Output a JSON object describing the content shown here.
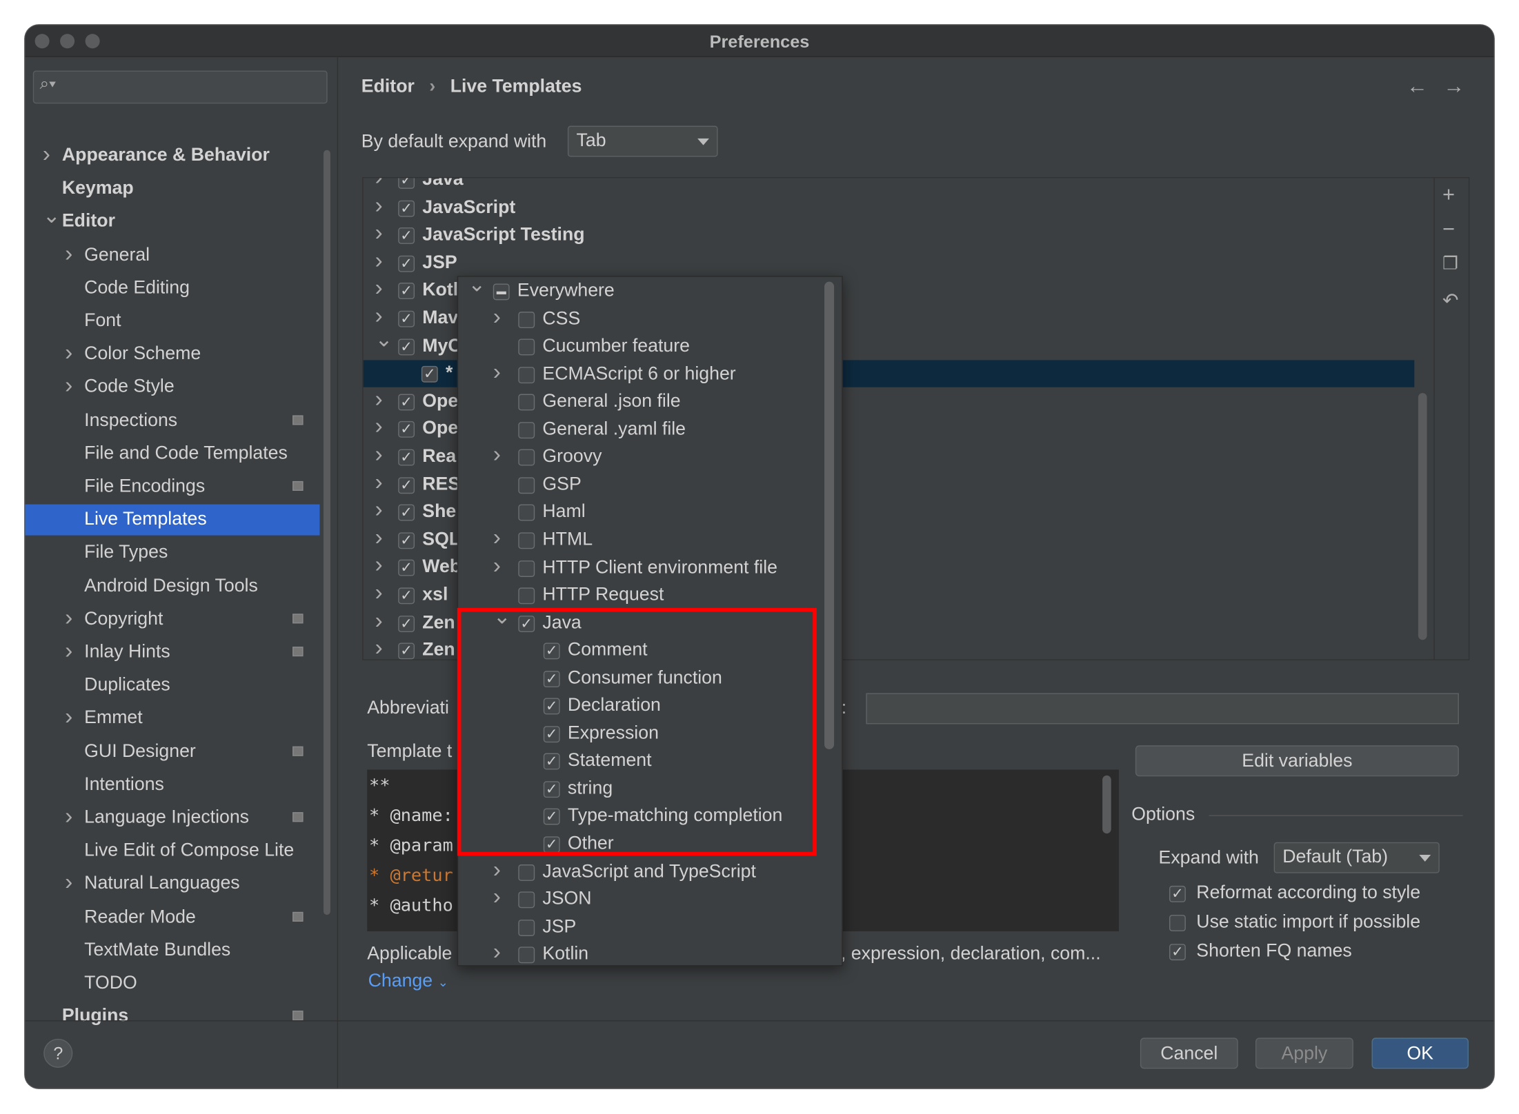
{
  "window": {
    "title": "Preferences"
  },
  "sidebar": {
    "search_placeholder": "",
    "items": [
      {
        "label": "Appearance & Behavior",
        "level": 0,
        "chevron": "right",
        "bold": true
      },
      {
        "label": "Keymap",
        "level": 0,
        "chevron": "",
        "bold": true
      },
      {
        "label": "Editor",
        "level": 0,
        "chevron": "down",
        "bold": true
      },
      {
        "label": "General",
        "level": 1,
        "chevron": "right"
      },
      {
        "label": "Code Editing",
        "level": 1,
        "chevron": ""
      },
      {
        "label": "Font",
        "level": 1,
        "chevron": ""
      },
      {
        "label": "Color Scheme",
        "level": 1,
        "chevron": "right"
      },
      {
        "label": "Code Style",
        "level": 1,
        "chevron": "right"
      },
      {
        "label": "Inspections",
        "level": 1,
        "chevron": "",
        "badge": true
      },
      {
        "label": "File and Code Templates",
        "level": 1,
        "chevron": ""
      },
      {
        "label": "File Encodings",
        "level": 1,
        "chevron": "",
        "badge": true
      },
      {
        "label": "Live Templates",
        "level": 1,
        "chevron": "",
        "selected": true
      },
      {
        "label": "File Types",
        "level": 1,
        "chevron": ""
      },
      {
        "label": "Android Design Tools",
        "level": 1,
        "chevron": ""
      },
      {
        "label": "Copyright",
        "level": 1,
        "chevron": "right",
        "badge": true
      },
      {
        "label": "Inlay Hints",
        "level": 1,
        "chevron": "right",
        "badge": true
      },
      {
        "label": "Duplicates",
        "level": 1,
        "chevron": ""
      },
      {
        "label": "Emmet",
        "level": 1,
        "chevron": "right"
      },
      {
        "label": "GUI Designer",
        "level": 1,
        "chevron": "",
        "badge": true
      },
      {
        "label": "Intentions",
        "level": 1,
        "chevron": ""
      },
      {
        "label": "Language Injections",
        "level": 1,
        "chevron": "right",
        "badge": true
      },
      {
        "label": "Live Edit of Compose Lite",
        "level": 1,
        "chevron": ""
      },
      {
        "label": "Natural Languages",
        "level": 1,
        "chevron": "right"
      },
      {
        "label": "Reader Mode",
        "level": 1,
        "chevron": "",
        "badge": true
      },
      {
        "label": "TextMate Bundles",
        "level": 1,
        "chevron": ""
      },
      {
        "label": "TODO",
        "level": 1,
        "chevron": ""
      },
      {
        "label": "Plugins",
        "level": 0,
        "chevron": "",
        "bold": true,
        "badge": true
      }
    ]
  },
  "breadcrumb": {
    "parent": "Editor",
    "separator": "›",
    "current": "Live Templates"
  },
  "expand": {
    "label": "By default expand with",
    "value": "Tab"
  },
  "template_groups": [
    {
      "label": "Java",
      "chevron": "right",
      "checked": true
    },
    {
      "label": "JavaScript",
      "chevron": "right",
      "checked": true
    },
    {
      "label": "JavaScript Testing",
      "chevron": "right",
      "checked": true
    },
    {
      "label": "JSP",
      "chevron": "right",
      "checked": true
    },
    {
      "label": "Kotl",
      "chevron": "right",
      "checked": true
    },
    {
      "label": "Mav",
      "chevron": "right",
      "checked": true
    },
    {
      "label": "MyC",
      "chevron": "down",
      "checked": true
    },
    {
      "label": "*",
      "chevron": "",
      "checked": true,
      "child": true,
      "selected": true
    },
    {
      "label": "Ope",
      "chevron": "right",
      "checked": true
    },
    {
      "label": "Ope",
      "chevron": "right",
      "checked": true
    },
    {
      "label": "Rea",
      "chevron": "right",
      "checked": true
    },
    {
      "label": "RES",
      "chevron": "right",
      "checked": true
    },
    {
      "label": "She",
      "chevron": "right",
      "checked": true
    },
    {
      "label": "SQL",
      "chevron": "right",
      "checked": true
    },
    {
      "label": "Web",
      "chevron": "right",
      "checked": true
    },
    {
      "label": "xsl",
      "chevron": "right",
      "checked": true
    },
    {
      "label": "Zen",
      "chevron": "right",
      "checked": true
    },
    {
      "label": "Zen",
      "chevron": "right",
      "checked": true
    }
  ],
  "context_popup": [
    {
      "label": "Everywhere",
      "level": 0,
      "chevron": "down",
      "state": "partial"
    },
    {
      "label": "CSS",
      "level": 1,
      "chevron": "right",
      "state": "unchecked"
    },
    {
      "label": "Cucumber feature",
      "level": 1,
      "chevron": "",
      "state": "unchecked"
    },
    {
      "label": "ECMAScript 6 or higher",
      "level": 1,
      "chevron": "right",
      "state": "unchecked"
    },
    {
      "label": "General .json file",
      "level": 1,
      "chevron": "",
      "state": "unchecked"
    },
    {
      "label": "General .yaml file",
      "level": 1,
      "chevron": "",
      "state": "unchecked"
    },
    {
      "label": "Groovy",
      "level": 1,
      "chevron": "right",
      "state": "unchecked"
    },
    {
      "label": "GSP",
      "level": 1,
      "chevron": "",
      "state": "unchecked"
    },
    {
      "label": "Haml",
      "level": 1,
      "chevron": "",
      "state": "unchecked"
    },
    {
      "label": "HTML",
      "level": 1,
      "chevron": "right",
      "state": "unchecked"
    },
    {
      "label": "HTTP Client environment file",
      "level": 1,
      "chevron": "right",
      "state": "unchecked"
    },
    {
      "label": "HTTP Request",
      "level": 1,
      "chevron": "",
      "state": "unchecked"
    },
    {
      "label": "Java",
      "level": 1,
      "chevron": "down",
      "state": "checked"
    },
    {
      "label": "Comment",
      "level": 2,
      "chevron": "",
      "state": "checked"
    },
    {
      "label": "Consumer function",
      "level": 2,
      "chevron": "",
      "state": "checked"
    },
    {
      "label": "Declaration",
      "level": 2,
      "chevron": "",
      "state": "checked"
    },
    {
      "label": "Expression",
      "level": 2,
      "chevron": "",
      "state": "checked"
    },
    {
      "label": "Statement",
      "level": 2,
      "chevron": "",
      "state": "checked"
    },
    {
      "label": "string",
      "level": 2,
      "chevron": "",
      "state": "checked"
    },
    {
      "label": "Type-matching completion",
      "level": 2,
      "chevron": "",
      "state": "checked"
    },
    {
      "label": "Other",
      "level": 2,
      "chevron": "",
      "state": "checked"
    },
    {
      "label": "JavaScript and TypeScript",
      "level": 1,
      "chevron": "right",
      "state": "unchecked"
    },
    {
      "label": "JSON",
      "level": 1,
      "chevron": "right",
      "state": "unchecked"
    },
    {
      "label": "JSP",
      "level": 1,
      "chevron": "",
      "state": "unchecked"
    },
    {
      "label": "Kotlin",
      "level": 1,
      "chevron": "right",
      "state": "unchecked"
    }
  ],
  "highlight_color": "#ff0000",
  "details": {
    "abbreviation_label": "Abbreviati",
    "description_label_tail": "n:",
    "description_value": "",
    "template_text_label": "Template t",
    "template_lines": [
      "**",
      "* @name:",
      "* @param",
      "* @retur",
      "* @autho"
    ],
    "edit_variables": "Edit variables",
    "applicable_label": "Applicable",
    "applicable_tail": ", expression, declaration, com...",
    "change_link": "Change"
  },
  "options": {
    "title": "Options",
    "expand_label": "Expand with",
    "expand_value": "Default (Tab)",
    "checkboxes": [
      {
        "label": "Reformat according to style",
        "checked": true
      },
      {
        "label": "Use static import if possible",
        "checked": false
      },
      {
        "label": "Shorten FQ names",
        "checked": true
      }
    ]
  },
  "toolbar_icons": [
    "add-icon",
    "remove-icon",
    "copy-icon",
    "restore-icon"
  ],
  "footer": {
    "cancel": "Cancel",
    "apply": "Apply",
    "ok": "OK",
    "help": "?"
  },
  "colors": {
    "selection": "#2f65ca",
    "link": "#589df6",
    "primary_button": "#365880"
  }
}
